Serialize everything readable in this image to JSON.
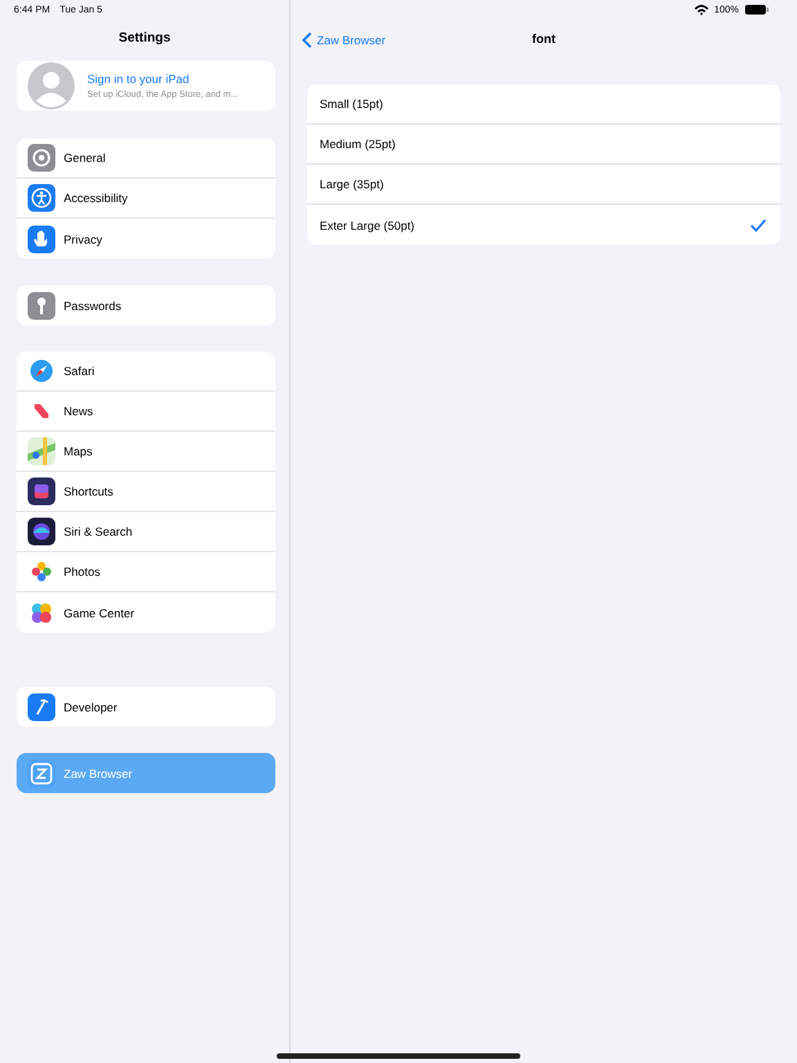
{
  "status_bar": {
    "time": "6:44 PM",
    "date": "Tue Jan 5",
    "battery": "100%"
  },
  "sidebar": {
    "title": "Settings",
    "account": {
      "title": "Sign in to your iPad",
      "subtitle": "Set up iCloud, the App Store, and m..."
    },
    "groups": [
      {
        "items": [
          {
            "label": "General",
            "selected": false
          },
          {
            "label": "Accessibility",
            "selected": false
          },
          {
            "label": "Privacy",
            "selected": false
          }
        ]
      },
      {
        "items": [
          {
            "label": "Passwords",
            "selected": false
          }
        ]
      },
      {
        "items": [
          {
            "label": "Safari",
            "selected": false
          },
          {
            "label": "News",
            "selected": false
          },
          {
            "label": "Maps",
            "selected": false
          },
          {
            "label": "Shortcuts",
            "selected": false
          },
          {
            "label": "Siri & Search",
            "selected": false
          },
          {
            "label": "Photos",
            "selected": false
          },
          {
            "label": "Game Center",
            "selected": false
          }
        ]
      },
      {
        "items": [
          {
            "label": "Developer",
            "selected": false
          }
        ]
      },
      {
        "items": [
          {
            "label": "Zaw Browser",
            "selected": true
          }
        ]
      }
    ]
  },
  "detail": {
    "back": "Zaw Browser",
    "title": "font",
    "options": [
      {
        "label": "Small (15pt)",
        "checked": false
      },
      {
        "label": "Medium (25pt)",
        "checked": false
      },
      {
        "label": "Large (35pt)",
        "checked": false
      },
      {
        "label": "Exter Large (50pt)",
        "checked": true
      }
    ]
  }
}
